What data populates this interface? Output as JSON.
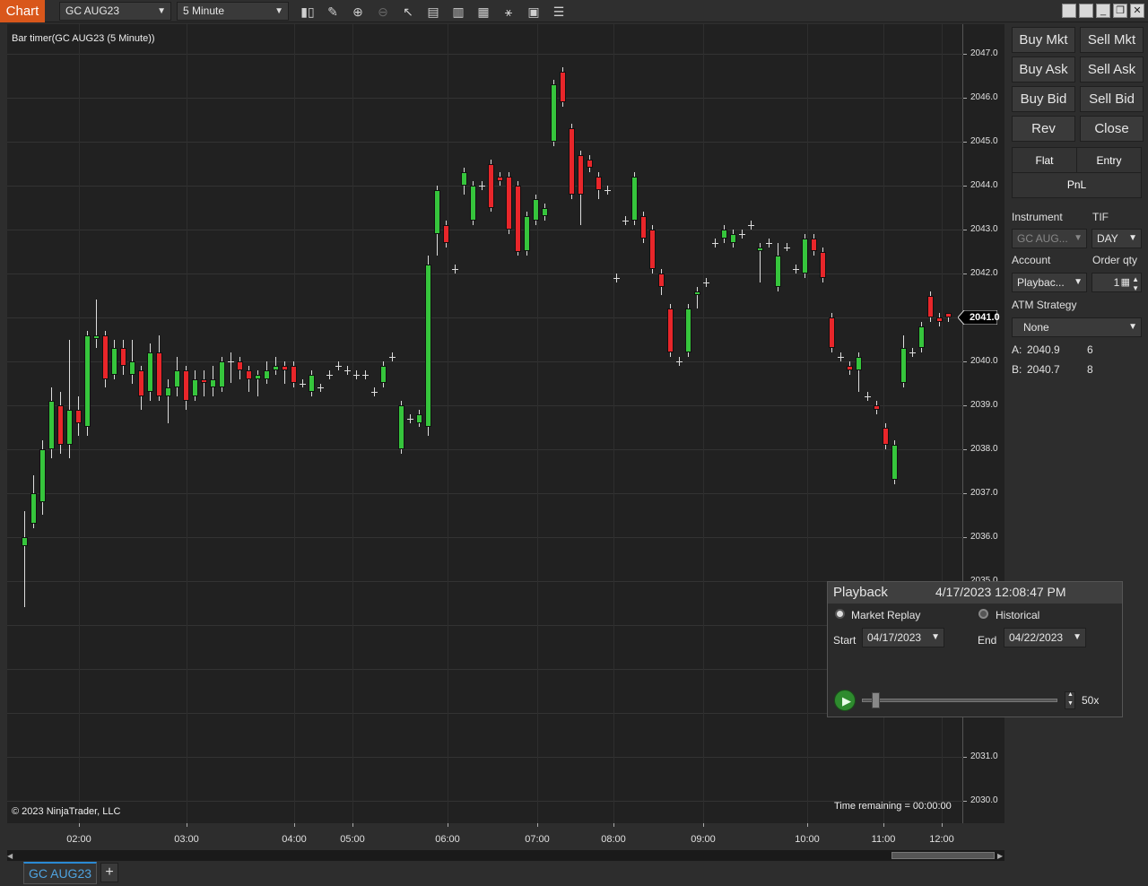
{
  "toolbar": {
    "chart_tab": "Chart",
    "instrument": "GC AUG23",
    "interval": "5 Minute",
    "icons": [
      "bar-type-icon",
      "drawing-tools-icon",
      "zoom-in-icon",
      "zoom-out-icon",
      "pointer-icon",
      "data-box-icon",
      "properties-icon",
      "indicators-icon",
      "strategies-icon",
      "templates-icon",
      "chart-trader-icon"
    ],
    "window_buttons": [
      "tile-icon",
      "tile-icon",
      "minimize-icon",
      "restore-icon",
      "close-icon"
    ]
  },
  "chart": {
    "indicator_label": "Bar timer(GC AUG23 (5 Minute))",
    "copyright": "© 2023 NinjaTrader, LLC",
    "time_remaining": "Time remaining = 00:00:00",
    "last_price_label": "2041.0",
    "bull_color": "#36c53c",
    "bear_color": "#e8262a"
  },
  "chart_data": {
    "type": "candlestick",
    "title": "Bar timer(GC AUG23 (5 Minute))",
    "y_ticks": [
      "2047.0",
      "2046.0",
      "2045.0",
      "2044.0",
      "2043.0",
      "2042.0",
      "2041.0",
      "2040.0",
      "2039.0",
      "2038.0",
      "2037.0",
      "2036.0",
      "2035.0",
      "2031.0",
      "2030.0"
    ],
    "x_ticks": [
      "02:00",
      "03:00",
      "04:00",
      "05:00",
      "06:00",
      "07:00",
      "08:00",
      "09:00",
      "10:00",
      "11:00",
      "12:00"
    ],
    "ylim": [
      2029.5,
      2047.5
    ],
    "last_price": 2041.0,
    "candles": [
      {
        "x": 27,
        "o": 2035.8,
        "c": 2036.0,
        "h": 2036.6,
        "l": 2034.4
      },
      {
        "x": 37,
        "o": 2036.3,
        "c": 2037.0,
        "h": 2037.4,
        "l": 2036.2
      },
      {
        "x": 47,
        "o": 2036.8,
        "c": 2038.0,
        "h": 2038.2,
        "l": 2036.5
      },
      {
        "x": 57,
        "o": 2038.0,
        "c": 2039.1,
        "h": 2039.4,
        "l": 2037.8
      },
      {
        "x": 67,
        "o": 2039.0,
        "c": 2038.1,
        "h": 2039.3,
        "l": 2037.9
      },
      {
        "x": 77,
        "o": 2038.1,
        "c": 2038.9,
        "h": 2040.5,
        "l": 2037.8
      },
      {
        "x": 87,
        "o": 2038.9,
        "c": 2038.6,
        "h": 2039.2,
        "l": 2038.3
      },
      {
        "x": 97,
        "o": 2038.5,
        "c": 2040.6,
        "h": 2040.7,
        "l": 2038.3
      },
      {
        "x": 107,
        "o": 2040.5,
        "c": 2040.6,
        "h": 2041.4,
        "l": 2040.3
      },
      {
        "x": 117,
        "o": 2040.6,
        "c": 2039.6,
        "h": 2040.7,
        "l": 2039.4
      },
      {
        "x": 127,
        "o": 2039.7,
        "c": 2040.3,
        "h": 2040.5,
        "l": 2039.6
      },
      {
        "x": 137,
        "o": 2040.3,
        "c": 2039.9,
        "h": 2040.5,
        "l": 2039.7
      },
      {
        "x": 147,
        "o": 2039.7,
        "c": 2040.0,
        "h": 2040.5,
        "l": 2039.5
      },
      {
        "x": 157,
        "o": 2039.8,
        "c": 2039.2,
        "h": 2039.9,
        "l": 2038.9
      },
      {
        "x": 167,
        "o": 2039.3,
        "c": 2040.2,
        "h": 2040.4,
        "l": 2039.1
      },
      {
        "x": 177,
        "o": 2040.2,
        "c": 2039.2,
        "h": 2040.6,
        "l": 2039.1
      },
      {
        "x": 187,
        "o": 2039.2,
        "c": 2039.4,
        "h": 2039.6,
        "l": 2038.6
      },
      {
        "x": 197,
        "o": 2039.4,
        "c": 2039.8,
        "h": 2040.1,
        "l": 2039.2
      },
      {
        "x": 207,
        "o": 2039.8,
        "c": 2039.1,
        "h": 2039.9,
        "l": 2038.9
      },
      {
        "x": 217,
        "o": 2039.2,
        "c": 2039.6,
        "h": 2039.8,
        "l": 2039.1
      },
      {
        "x": 227,
        "o": 2039.6,
        "c": 2039.5,
        "h": 2039.8,
        "l": 2039.2
      },
      {
        "x": 237,
        "o": 2039.4,
        "c": 2039.6,
        "h": 2039.9,
        "l": 2039.2
      },
      {
        "x": 247,
        "o": 2039.4,
        "c": 2040.0,
        "h": 2040.1,
        "l": 2039.3
      },
      {
        "x": 257,
        "o": 2040.0,
        "c": 2040.0,
        "h": 2040.2,
        "l": 2039.5
      },
      {
        "x": 267,
        "o": 2040.0,
        "c": 2039.8,
        "h": 2040.1,
        "l": 2039.6
      },
      {
        "x": 277,
        "o": 2039.8,
        "c": 2039.6,
        "h": 2039.9,
        "l": 2039.3
      },
      {
        "x": 287,
        "o": 2039.6,
        "c": 2039.7,
        "h": 2039.8,
        "l": 2039.2
      },
      {
        "x": 297,
        "o": 2039.6,
        "c": 2039.8,
        "h": 2040.0,
        "l": 2039.5
      },
      {
        "x": 307,
        "o": 2039.8,
        "c": 2039.9,
        "h": 2040.1,
        "l": 2039.7
      },
      {
        "x": 317,
        "o": 2039.9,
        "c": 2039.8,
        "h": 2040.0,
        "l": 2039.5
      },
      {
        "x": 327,
        "o": 2039.9,
        "c": 2039.5,
        "h": 2040.0,
        "l": 2039.4
      },
      {
        "x": 337,
        "o": 2039.5,
        "c": 2039.5,
        "h": 2039.6,
        "l": 2039.4
      },
      {
        "x": 347,
        "o": 2039.3,
        "c": 2039.7,
        "h": 2039.8,
        "l": 2039.2
      },
      {
        "x": 357,
        "o": 2039.4,
        "c": 2039.4,
        "h": 2039.5,
        "l": 2039.3
      },
      {
        "x": 367,
        "o": 2039.7,
        "c": 2039.7,
        "h": 2039.8,
        "l": 2039.6
      },
      {
        "x": 377,
        "o": 2039.9,
        "c": 2039.9,
        "h": 2040.0,
        "l": 2039.8
      },
      {
        "x": 387,
        "o": 2039.8,
        "c": 2039.8,
        "h": 2039.9,
        "l": 2039.7
      },
      {
        "x": 397,
        "o": 2039.7,
        "c": 2039.7,
        "h": 2039.8,
        "l": 2039.6
      },
      {
        "x": 407,
        "o": 2039.7,
        "c": 2039.7,
        "h": 2039.8,
        "l": 2039.6
      },
      {
        "x": 417,
        "o": 2039.3,
        "c": 2039.3,
        "h": 2039.4,
        "l": 2039.2
      },
      {
        "x": 427,
        "o": 2039.5,
        "c": 2039.9,
        "h": 2040.0,
        "l": 2039.4
      },
      {
        "x": 437,
        "o": 2040.1,
        "c": 2040.1,
        "h": 2040.2,
        "l": 2040.0
      },
      {
        "x": 447,
        "o": 2038.0,
        "c": 2039.0,
        "h": 2039.1,
        "l": 2037.9
      },
      {
        "x": 457,
        "o": 2038.7,
        "c": 2038.7,
        "h": 2038.8,
        "l": 2038.6
      },
      {
        "x": 467,
        "o": 2038.6,
        "c": 2038.8,
        "h": 2038.9,
        "l": 2038.5
      },
      {
        "x": 477,
        "o": 2038.5,
        "c": 2042.2,
        "h": 2042.4,
        "l": 2038.3
      },
      {
        "x": 487,
        "o": 2042.9,
        "c": 2043.9,
        "h": 2044.0,
        "l": 2042.4
      },
      {
        "x": 497,
        "o": 2043.1,
        "c": 2042.7,
        "h": 2043.2,
        "l": 2042.6
      },
      {
        "x": 507,
        "o": 2042.1,
        "c": 2042.1,
        "h": 2042.2,
        "l": 2042.0
      },
      {
        "x": 517,
        "o": 2044.0,
        "c": 2044.3,
        "h": 2044.4,
        "l": 2043.8
      },
      {
        "x": 527,
        "o": 2043.2,
        "c": 2044.0,
        "h": 2044.1,
        "l": 2043.1
      },
      {
        "x": 537,
        "o": 2044.0,
        "c": 2044.0,
        "h": 2044.1,
        "l": 2043.9
      },
      {
        "x": 547,
        "o": 2044.5,
        "c": 2043.5,
        "h": 2044.6,
        "l": 2043.4
      },
      {
        "x": 557,
        "o": 2044.2,
        "c": 2044.1,
        "h": 2044.3,
        "l": 2044.0
      },
      {
        "x": 567,
        "o": 2044.2,
        "c": 2043.0,
        "h": 2044.3,
        "l": 2042.9
      },
      {
        "x": 577,
        "o": 2044.0,
        "c": 2042.5,
        "h": 2044.1,
        "l": 2042.4
      },
      {
        "x": 587,
        "o": 2042.5,
        "c": 2043.3,
        "h": 2043.4,
        "l": 2042.4
      },
      {
        "x": 597,
        "o": 2043.2,
        "c": 2043.7,
        "h": 2043.8,
        "l": 2043.1
      },
      {
        "x": 607,
        "o": 2043.3,
        "c": 2043.5,
        "h": 2043.6,
        "l": 2043.2
      },
      {
        "x": 617,
        "o": 2045.0,
        "c": 2046.3,
        "h": 2046.4,
        "l": 2044.9
      },
      {
        "x": 627,
        "o": 2046.6,
        "c": 2045.9,
        "h": 2046.7,
        "l": 2045.8
      },
      {
        "x": 637,
        "o": 2045.3,
        "c": 2043.8,
        "h": 2045.4,
        "l": 2043.7
      },
      {
        "x": 647,
        "o": 2044.7,
        "c": 2043.8,
        "h": 2044.8,
        "l": 2043.1
      },
      {
        "x": 657,
        "o": 2044.6,
        "c": 2044.4,
        "h": 2044.7,
        "l": 2044.3
      },
      {
        "x": 667,
        "o": 2044.2,
        "c": 2043.9,
        "h": 2044.3,
        "l": 2043.7
      },
      {
        "x": 677,
        "o": 2043.9,
        "c": 2043.9,
        "h": 2044.0,
        "l": 2043.8
      },
      {
        "x": 687,
        "o": 2041.9,
        "c": 2041.9,
        "h": 2042.0,
        "l": 2041.8
      },
      {
        "x": 697,
        "o": 2043.2,
        "c": 2043.2,
        "h": 2043.3,
        "l": 2043.1
      },
      {
        "x": 707,
        "o": 2043.2,
        "c": 2044.2,
        "h": 2044.3,
        "l": 2043.1
      },
      {
        "x": 717,
        "o": 2043.3,
        "c": 2042.8,
        "h": 2043.4,
        "l": 2042.7
      },
      {
        "x": 727,
        "o": 2043.0,
        "c": 2042.1,
        "h": 2043.1,
        "l": 2042.0
      },
      {
        "x": 737,
        "o": 2042.0,
        "c": 2041.7,
        "h": 2042.1,
        "l": 2041.5
      },
      {
        "x": 747,
        "o": 2041.2,
        "c": 2040.2,
        "h": 2041.3,
        "l": 2040.1
      },
      {
        "x": 757,
        "o": 2040.0,
        "c": 2040.0,
        "h": 2040.1,
        "l": 2039.9
      },
      {
        "x": 767,
        "o": 2040.2,
        "c": 2041.2,
        "h": 2041.3,
        "l": 2040.1
      },
      {
        "x": 777,
        "o": 2041.5,
        "c": 2041.6,
        "h": 2041.7,
        "l": 2041.2
      },
      {
        "x": 787,
        "o": 2041.8,
        "c": 2041.8,
        "h": 2041.9,
        "l": 2041.7
      },
      {
        "x": 797,
        "o": 2042.7,
        "c": 2042.7,
        "h": 2042.8,
        "l": 2042.6
      },
      {
        "x": 807,
        "o": 2042.8,
        "c": 2043.0,
        "h": 2043.1,
        "l": 2042.7
      },
      {
        "x": 817,
        "o": 2042.7,
        "c": 2042.9,
        "h": 2043.0,
        "l": 2042.6
      },
      {
        "x": 827,
        "o": 2042.9,
        "c": 2042.9,
        "h": 2043.0,
        "l": 2042.8
      },
      {
        "x": 837,
        "o": 2043.1,
        "c": 2043.1,
        "h": 2043.2,
        "l": 2043.0
      },
      {
        "x": 847,
        "o": 2042.5,
        "c": 2042.6,
        "h": 2042.7,
        "l": 2041.8
      },
      {
        "x": 857,
        "o": 2042.7,
        "c": 2042.7,
        "h": 2042.8,
        "l": 2042.6
      },
      {
        "x": 867,
        "o": 2041.7,
        "c": 2042.4,
        "h": 2042.7,
        "l": 2041.6
      },
      {
        "x": 877,
        "o": 2042.6,
        "c": 2042.6,
        "h": 2042.7,
        "l": 2042.5
      },
      {
        "x": 887,
        "o": 2042.1,
        "c": 2042.1,
        "h": 2042.2,
        "l": 2042.0
      },
      {
        "x": 897,
        "o": 2042.0,
        "c": 2042.8,
        "h": 2042.9,
        "l": 2041.9
      },
      {
        "x": 907,
        "o": 2042.8,
        "c": 2042.5,
        "h": 2042.9,
        "l": 2042.4
      },
      {
        "x": 917,
        "o": 2042.5,
        "c": 2041.9,
        "h": 2042.6,
        "l": 2041.8
      },
      {
        "x": 927,
        "o": 2041.0,
        "c": 2040.3,
        "h": 2041.1,
        "l": 2040.2
      },
      {
        "x": 937,
        "o": 2040.1,
        "c": 2040.1,
        "h": 2040.2,
        "l": 2040.0
      },
      {
        "x": 947,
        "o": 2039.9,
        "c": 2039.8,
        "h": 2040.0,
        "l": 2039.7
      },
      {
        "x": 957,
        "o": 2039.8,
        "c": 2040.1,
        "h": 2040.2,
        "l": 2039.3
      },
      {
        "x": 967,
        "o": 2039.2,
        "c": 2039.2,
        "h": 2039.3,
        "l": 2039.1
      },
      {
        "x": 977,
        "o": 2039.0,
        "c": 2038.9,
        "h": 2039.1,
        "l": 2038.8
      },
      {
        "x": 987,
        "o": 2038.5,
        "c": 2038.1,
        "h": 2038.6,
        "l": 2038.0
      },
      {
        "x": 997,
        "o": 2037.3,
        "c": 2038.1,
        "h": 2038.2,
        "l": 2037.2
      },
      {
        "x": 1007,
        "o": 2039.5,
        "c": 2040.3,
        "h": 2040.6,
        "l": 2039.4
      },
      {
        "x": 1017,
        "o": 2040.2,
        "c": 2040.2,
        "h": 2040.3,
        "l": 2040.1
      },
      {
        "x": 1027,
        "o": 2040.3,
        "c": 2040.8,
        "h": 2040.9,
        "l": 2040.2
      },
      {
        "x": 1037,
        "o": 2041.5,
        "c": 2041.0,
        "h": 2041.6,
        "l": 2040.9
      },
      {
        "x": 1047,
        "o": 2041.0,
        "c": 2040.9,
        "h": 2041.1,
        "l": 2040.8
      },
      {
        "x": 1057,
        "o": 2041.1,
        "c": 2041.0,
        "h": 2041.1,
        "l": 2040.9
      }
    ]
  },
  "trader": {
    "buy_mkt": "Buy Mkt",
    "sell_mkt": "Sell Mkt",
    "buy_ask": "Buy Ask",
    "sell_ask": "Sell Ask",
    "buy_bid": "Buy Bid",
    "sell_bid": "Sell Bid",
    "rev": "Rev",
    "close": "Close",
    "flat": "Flat",
    "entry": "Entry",
    "pnl": "PnL",
    "instrument_label": "Instrument",
    "instrument_value": "GC AUG...",
    "tif_label": "TIF",
    "tif_value": "DAY",
    "account_label": "Account",
    "account_value": "Playbac...",
    "qty_label": "Order qty",
    "qty_value": "1",
    "atm_label": "ATM Strategy",
    "atm_value": "None",
    "ask_label": "A:",
    "ask_price": "2040.9",
    "ask_size": "6",
    "bid_label": "B:",
    "bid_price": "2040.7",
    "bid_size": "8"
  },
  "playback": {
    "title": "Playback",
    "datetime": "4/17/2023 12:08:47 PM",
    "market_replay": "Market Replay",
    "historical": "Historical",
    "start_label": "Start",
    "start_value": "04/17/2023",
    "end_label": "End",
    "end_value": "04/22/2023",
    "speed": "50x",
    "speed_slider_fraction": 0.05
  },
  "bottom": {
    "tab_label": "GC AUG23",
    "add_tab": "+"
  }
}
